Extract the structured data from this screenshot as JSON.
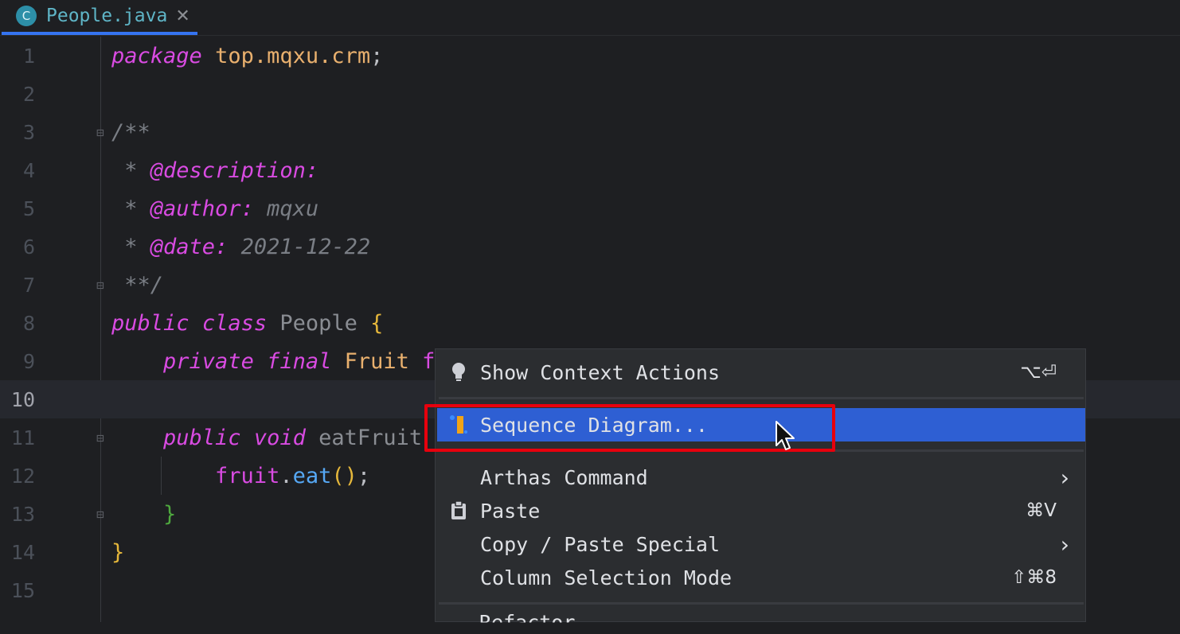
{
  "tab": {
    "icon_letter": "C",
    "title": "People.java",
    "close": "✕"
  },
  "editor": {
    "line_numbers": [
      "1",
      "2",
      "3",
      "4",
      "5",
      "6",
      "7",
      "8",
      "9",
      "10",
      "11",
      "12",
      "13",
      "14",
      "15"
    ],
    "l1": {
      "kw": "package",
      "pkg": "top.mqxu.crm",
      "semi": ";"
    },
    "l3": "/**",
    "l4": {
      "star": " * ",
      "tag": "@description:"
    },
    "l5": {
      "star": " * ",
      "tag": "@author:",
      "val": " mqxu"
    },
    "l6": {
      "star": " * ",
      "tag": "@date:",
      "val": " 2021-12-22"
    },
    "l7": " **/",
    "l8": {
      "kw1": "public",
      "kw2": "class",
      "name": "People",
      "brace": "{"
    },
    "l9": {
      "kw1": "private",
      "kw2": "final",
      "type": "Fruit",
      "rest": " f"
    },
    "l11": {
      "kw1": "public",
      "kw2": "void",
      "name": "eatFruit"
    },
    "l12": {
      "field": "fruit",
      "dot": ".",
      "method": "eat",
      "paren": "()",
      "semi": ";"
    },
    "l13": "}",
    "l14": "}"
  },
  "menu": {
    "items": [
      {
        "label": "Show Context Actions",
        "shortcut": "⌥⏎",
        "icon": "lightbulb-icon"
      },
      {
        "label": "Sequence Diagram...",
        "icon": "sequence-diagram-icon",
        "selected": true
      },
      {
        "label": "Arthas Command",
        "submenu": "›"
      },
      {
        "label": "Paste",
        "shortcut": "⌘V",
        "icon": "clipboard-icon"
      },
      {
        "label": "Copy / Paste Special",
        "submenu": "›"
      },
      {
        "label": "Column Selection Mode",
        "shortcut": "⇧⌘8"
      },
      {
        "label": "Refactor"
      }
    ]
  },
  "colors": {
    "accent": "#3574f0",
    "selection": "#2e5fd3",
    "highlight_box": "#e8000d"
  }
}
